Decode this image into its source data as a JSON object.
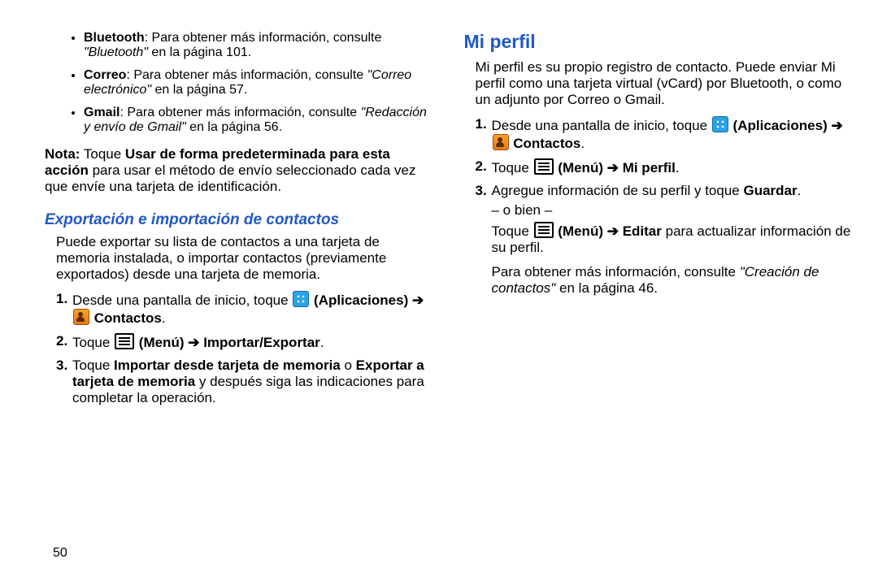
{
  "left": {
    "bullets": [
      {
        "label": "Bluetooth",
        "text": ": Para obtener más información, consulte ",
        "ref": "\"Bluetooth\"",
        "tail": " en la página 101."
      },
      {
        "label": "Correo",
        "text": ": Para obtener más información, consulte ",
        "ref": "\"Correo electrónico\"",
        "tail": " en la página 57."
      },
      {
        "label": "Gmail",
        "text": ": Para obtener más información, consulte ",
        "ref": "\"Redacción y envío de Gmail\"",
        "tail": " en la página 56."
      }
    ],
    "nota_label": "Nota:",
    "nota_bold": "Usar de forma predeterminada para esta acción",
    "nota_before": " Toque ",
    "nota_after": " para usar el método de envío seleccionado cada vez que envíe una tarjeta de identificación.",
    "sub_heading": "Exportación e importación de contactos",
    "intro": "Puede exportar su lista de contactos a una tarjeta de memoria instalada, o importar contactos (previamente exportados) desde una tarjeta de memoria.",
    "steps": {
      "s1a": "Desde una pantalla de inicio, toque ",
      "apps": "(Aplicaciones)",
      "arrow": " ➔ ",
      "contacts": "Contactos",
      "s2a": "Toque ",
      "menu": "(Menú)",
      "s2b": "Importar/Exportar",
      "s3a": "Toque ",
      "s3b": "Importar desde tarjeta de memoria",
      "s3c": " o ",
      "s3d": "Exportar a tarjeta de memoria",
      "s3e": " y después siga las indicaciones para completar la operación."
    }
  },
  "right": {
    "heading": "Mi perfil",
    "intro": "Mi perfil es su propio registro de contacto. Puede enviar Mi perfil como una tarjeta virtual (vCard) por Bluetooth, o como un adjunto por Correo o Gmail.",
    "steps": {
      "s1a": "Desde una pantalla de inicio, toque ",
      "apps": "(Aplicaciones)",
      "arrow": " ➔ ",
      "contacts": "Contactos",
      "s2a": "Toque ",
      "menu": "(Menú)",
      "s2b": "Mi perfil",
      "s3a": "Agregue información de su perfil y toque ",
      "s3b": "Guardar",
      "or": "– o bien –",
      "s3c": "Toque ",
      "s3d": "(Menú)",
      "s3e": "Editar",
      "s3f": " para actualizar información de su perfil.",
      "s3g": "Para obtener más información, consulte ",
      "s3h": "\"Creación de contactos\"",
      "s3i": " en la página 46."
    }
  },
  "page_number": "50"
}
